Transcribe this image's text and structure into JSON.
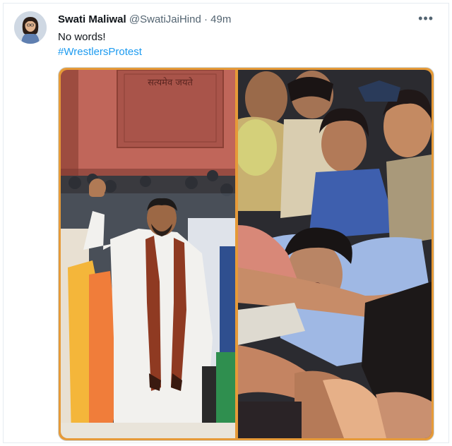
{
  "tweet": {
    "author_name": "Swati Maliwal",
    "handle": "@SwatiJaiHind",
    "separator": "·",
    "time": "49m",
    "text": "No words!",
    "hashtag": "#WrestlersProtest",
    "more_icon": "more-horizontal-icon"
  },
  "media": {
    "border_color": "#e69a38",
    "left_image": {
      "inscription": "सत्यमेव जयते",
      "description": "man in white kurta with orange stole waving in front of red sandstone building"
    },
    "right_image": {
      "description": "woman wrestler in blue shirt being detained by police officers"
    }
  },
  "colors": {
    "link": "#1d9bf0",
    "secondary_text": "#536471",
    "primary_text": "#0f1419"
  }
}
